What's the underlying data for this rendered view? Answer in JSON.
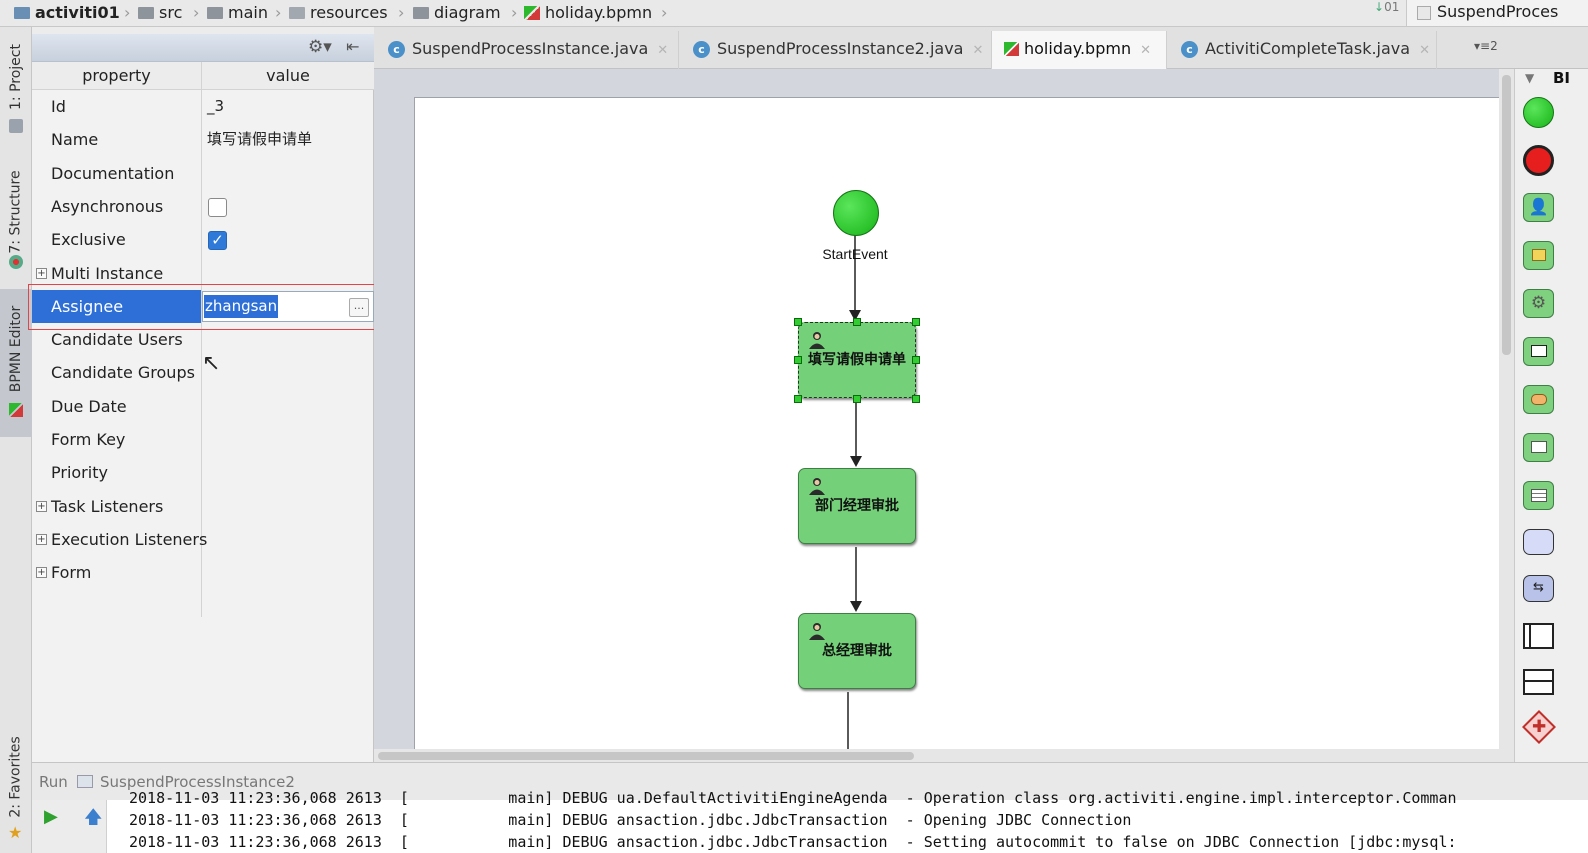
{
  "breadcrumb": {
    "items": [
      "activiti01",
      "src",
      "main",
      "resources",
      "diagram",
      "holiday.bpmn"
    ],
    "right_label": "SuspendProces"
  },
  "left_strip": {
    "project": "1: Project",
    "structure": "7: Structure",
    "bpmn": "BPMN Editor",
    "favorites": "2: Favorites"
  },
  "properties": {
    "header_property": "property",
    "header_value": "value",
    "rows": [
      {
        "name": "Id",
        "value": "_3"
      },
      {
        "name": "Name",
        "value": "填写请假申请单"
      },
      {
        "name": "Documentation",
        "value": ""
      },
      {
        "name": "Asynchronous",
        "checked": false
      },
      {
        "name": "Exclusive",
        "checked": true
      },
      {
        "name": "Multi Instance",
        "expandable": true
      },
      {
        "name": "Assignee",
        "value": "zhangsan",
        "selected": true
      },
      {
        "name": "Candidate Users",
        "value": ""
      },
      {
        "name": "Candidate Groups",
        "value": ""
      },
      {
        "name": "Due Date",
        "value": ""
      },
      {
        "name": "Form Key",
        "value": ""
      },
      {
        "name": "Priority",
        "value": ""
      },
      {
        "name": "Task Listeners",
        "expandable": true
      },
      {
        "name": "Execution Listeners",
        "expandable": true
      },
      {
        "name": "Form",
        "expandable": true
      }
    ],
    "ellipsis": "..."
  },
  "editor_tabs": [
    {
      "label": "SuspendProcessInstance.java",
      "active": false
    },
    {
      "label": "SuspendProcessInstance2.java",
      "active": false
    },
    {
      "label": "holiday.bpmn",
      "active": true
    },
    {
      "label": "ActivitiCompleteTask.java",
      "active": false
    }
  ],
  "tabs_overflow": "2",
  "diagram": {
    "start_label": "StartEvent",
    "tasks": [
      {
        "name": "填写请假申请单",
        "selected": true
      },
      {
        "name": "部门经理审批",
        "selected": false
      },
      {
        "name": "总经理审批",
        "selected": false
      }
    ]
  },
  "palette": {
    "header": "BI",
    "icons": [
      "start-event-icon",
      "end-event-icon",
      "user-task-icon",
      "script-task-icon",
      "service-task-icon",
      "mail-task-icon",
      "manual-task-icon",
      "receive-task-icon",
      "business-rule-task-icon",
      "sub-process-icon",
      "call-activity-icon",
      "pool-icon",
      "lane-icon",
      "exclusive-gateway-icon"
    ]
  },
  "run": {
    "label": "Run",
    "config": "SuspendProcessInstance2"
  },
  "console": {
    "lines": [
      "2018-11-03 11:23:36,068 2613  [           main] DEBUG ua.DefaultActivitiEngineAgenda  - Operation class org.activiti.engine.impl.interceptor.Comman",
      "2018-11-03 11:23:36,068 2613  [           main] DEBUG ansaction.jdbc.JdbcTransaction  - Opening JDBC Connection",
      "2018-11-03 11:23:36,068 2613  [           main] DEBUG ansaction.jdbc.JdbcTransaction  - Setting autocommit to false on JDBC Connection [jdbc:mysql:"
    ]
  },
  "colors": {
    "selection": "#2d6fd6",
    "highlight_border": "#e0454a",
    "task_fill": "#74d17a",
    "start_fill": "#22c322",
    "end_fill": "#e61e1e"
  }
}
